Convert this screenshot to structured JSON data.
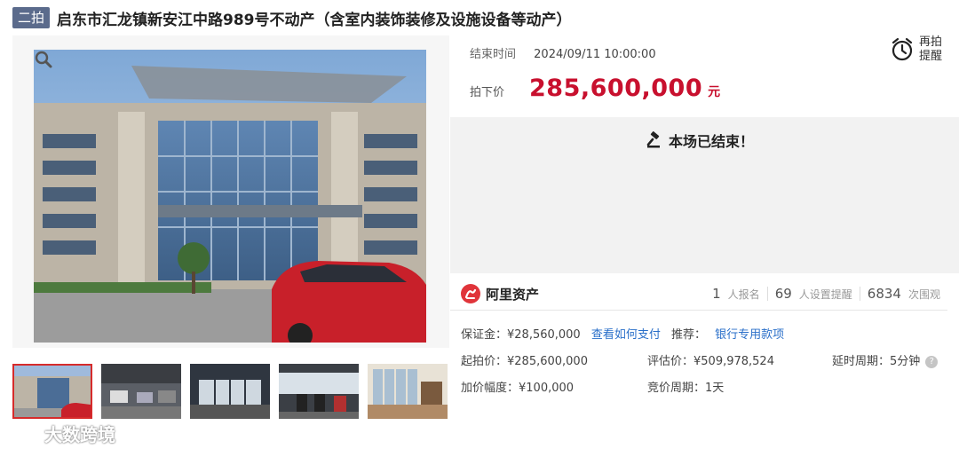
{
  "header": {
    "badge": "二拍",
    "title": "启东市汇龙镇新安江中路989号不动产（含室内装饰装修及设施设备等动产）"
  },
  "auction": {
    "end_time_label": "结束时间",
    "end_time_value": "2024/09/11 10:00:00",
    "final_price_label": "拍下价",
    "final_price_value": "285,600,000",
    "final_price_unit": "元",
    "remind_label": "再拍提醒",
    "ended_text": "本场已结束！"
  },
  "brand": {
    "name": "阿里资产"
  },
  "stats": {
    "registered_count": "1",
    "registered_label": "人报名",
    "reminder_count": "69",
    "reminder_label": "人设置提醒",
    "views_count": "6834",
    "views_label": "次围观"
  },
  "details": {
    "deposit": "保证金：¥28,560,000",
    "how_to_pay": "查看如何支付",
    "recommend_label": "推荐：",
    "recommend_link": "银行专用款项",
    "start_price": "起拍价：¥285,600,000",
    "appraised_price": "评估价：¥509,978,524",
    "delay_period": "延时周期：5分钟",
    "increment": "加价幅度：¥100,000",
    "bid_period": "竞价周期：1天"
  },
  "watermark": {
    "text": "大数跨境"
  },
  "colors": {
    "price": "#c8102e",
    "badge": "#5b6b8c",
    "link": "#2a6fc9",
    "brand": "#e0343a"
  }
}
